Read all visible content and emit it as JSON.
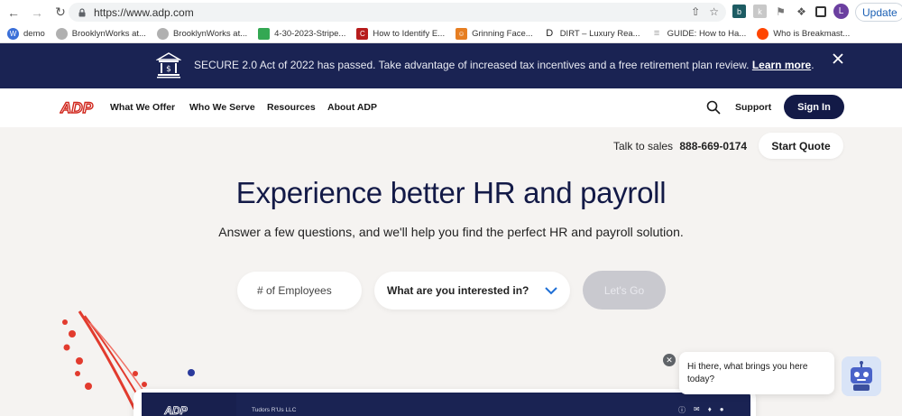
{
  "browser": {
    "url": "https://www.adp.com",
    "update_label": "Update",
    "avatar_letter": "L",
    "bookmarks": [
      {
        "label": "demo",
        "color": "#3a6fd8"
      },
      {
        "label": "BrooklynWorks at...",
        "color": "#b0b0b0"
      },
      {
        "label": "BrooklynWorks at...",
        "color": "#b0b0b0"
      },
      {
        "label": "4-30-2023-Stripe...",
        "color": "#34a853"
      },
      {
        "label": "How to Identify E...",
        "color": "#b71c1c"
      },
      {
        "label": "Grinning Face...",
        "color": "#e67e22"
      },
      {
        "label": "DIRT – Luxury Rea...",
        "color": "#222222"
      },
      {
        "label": "GUIDE: How to Ha...",
        "color": "#9e9e9e"
      },
      {
        "label": "Who is Breakmast...",
        "color": "#ff4500"
      }
    ]
  },
  "banner": {
    "text": "SECURE 2.0 Act of 2022 has passed. Take advantage of increased tax incentives and a free retirement plan review.",
    "link": "Learn more",
    "end": "."
  },
  "nav": {
    "logo": "ADP",
    "items": [
      "What We Offer",
      "Who We Serve",
      "Resources",
      "About ADP"
    ],
    "support": "Support",
    "signin": "Sign In"
  },
  "hero": {
    "talk_label": "Talk to sales",
    "phone": "888-669-0174",
    "start_quote": "Start Quote",
    "headline": "Experience better HR and payroll",
    "subline": "Answer a few questions, and we'll help you find the perfect HR and payroll solution.",
    "employees_placeholder": "# of Employees",
    "interest_label": "What are you interested in?",
    "go_label": "Let's Go"
  },
  "preview": {
    "logo": "ADP",
    "company": "Tudors R'Us LLC"
  },
  "chat": {
    "message": "Hi there, what brings you here today?"
  },
  "colors": {
    "navy": "#1a2353",
    "brand_red": "#d0271d",
    "signin_bg": "#131a47"
  }
}
